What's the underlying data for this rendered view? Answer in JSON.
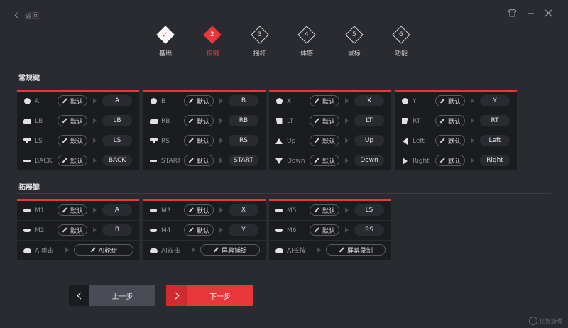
{
  "header": {
    "back_label": "返回"
  },
  "steps": [
    {
      "num": "✓",
      "label": "基础",
      "state": "done"
    },
    {
      "num": "2",
      "label": "按键",
      "state": "active"
    },
    {
      "num": "3",
      "label": "摇杆",
      "state": "todo"
    },
    {
      "num": "4",
      "label": "体感",
      "state": "todo"
    },
    {
      "num": "5",
      "label": "鼠标",
      "state": "todo"
    },
    {
      "num": "6",
      "label": "功能",
      "state": "todo"
    }
  ],
  "regular": {
    "title": "常规键",
    "default_label": "默认",
    "columns": [
      [
        {
          "name": "A",
          "value": "A",
          "icon": "circle-icon"
        },
        {
          "name": "LB",
          "value": "LB",
          "icon": "lb-icon"
        },
        {
          "name": "LS",
          "value": "LS",
          "icon": "ls-icon"
        },
        {
          "name": "BACK",
          "value": "BACK",
          "icon": "back-icon"
        }
      ],
      [
        {
          "name": "B",
          "value": "B",
          "icon": "circle-icon"
        },
        {
          "name": "RB",
          "value": "RB",
          "icon": "rb-icon"
        },
        {
          "name": "RS",
          "value": "RS",
          "icon": "rs-icon"
        },
        {
          "name": "START",
          "value": "START",
          "icon": "start-icon"
        }
      ],
      [
        {
          "name": "X",
          "value": "X",
          "icon": "circle-icon"
        },
        {
          "name": "LT",
          "value": "LT",
          "icon": "lt-icon"
        },
        {
          "name": "Up",
          "value": "Up",
          "icon": "dpad-up-icon"
        },
        {
          "name": "Down",
          "value": "Down",
          "icon": "dpad-down-icon"
        }
      ],
      [
        {
          "name": "Y",
          "value": "Y",
          "icon": "circle-icon"
        },
        {
          "name": "RT",
          "value": "RT",
          "icon": "rt-icon"
        },
        {
          "name": "Left",
          "value": "Left",
          "icon": "dpad-left-icon"
        },
        {
          "name": "Right",
          "value": "Right",
          "icon": "dpad-right-icon"
        }
      ]
    ]
  },
  "extended": {
    "title": "拓展键",
    "default_label": "默认",
    "columns": [
      {
        "rows": [
          {
            "name": "M1",
            "value": "A"
          },
          {
            "name": "M2",
            "value": "B"
          }
        ],
        "ai": {
          "name": "AI单击",
          "action": "AI轮盘"
        }
      },
      {
        "rows": [
          {
            "name": "M3",
            "value": "X"
          },
          {
            "name": "M4",
            "value": "Y"
          }
        ],
        "ai": {
          "name": "AI双击",
          "action": "屏幕捕捉"
        }
      },
      {
        "rows": [
          {
            "name": "M5",
            "value": "LS"
          },
          {
            "name": "M6",
            "value": "RS"
          }
        ],
        "ai": {
          "name": "AI长按",
          "action": "屏幕录制"
        }
      }
    ]
  },
  "footer": {
    "prev_label": "上一步",
    "next_label": "下一步"
  },
  "watermark": "亿智游戏",
  "colors": {
    "accent": "#e8363a",
    "bg": "#2a2b30",
    "card": "#1b1c20"
  }
}
